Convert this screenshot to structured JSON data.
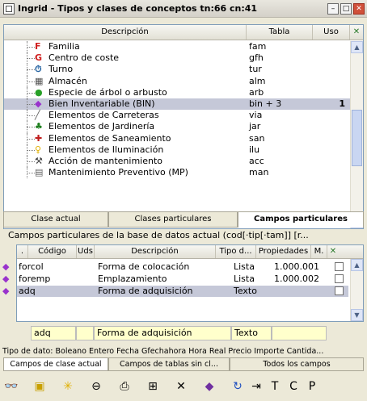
{
  "window": {
    "title": "Ingrid - Tipos y clases de conceptos tn:66 cn:41",
    "minimize": "–",
    "maximize": "□",
    "close": "✕"
  },
  "grid": {
    "columns": [
      "Descripción",
      "Tabla",
      "Uso"
    ],
    "rows": [
      {
        "icon": "letter-f-icon",
        "desc": "Familia",
        "tabla": "fam",
        "uso": ""
      },
      {
        "icon": "letter-g-icon",
        "desc": "Centro de coste",
        "tabla": "gfh",
        "uso": ""
      },
      {
        "icon": "shift-icon",
        "desc": "Turno",
        "tabla": "tur",
        "uso": ""
      },
      {
        "icon": "warehouse-icon",
        "desc": "Almacén",
        "tabla": "alm",
        "uso": ""
      },
      {
        "icon": "leaf-icon",
        "desc": "Especie de árbol o arbusto",
        "tabla": "arb",
        "uso": ""
      },
      {
        "icon": "gem-icon",
        "desc": "Bien Inventariable (BIN)",
        "tabla": "bin + 3",
        "uso": "1"
      },
      {
        "icon": "road-icon",
        "desc": "Elementos de Carreteras",
        "tabla": "via",
        "uso": ""
      },
      {
        "icon": "tree-icon",
        "desc": "Elementos de Jardinería",
        "tabla": "jar",
        "uso": ""
      },
      {
        "icon": "pipe-icon",
        "desc": "Elementos de Saneamiento",
        "tabla": "san",
        "uso": ""
      },
      {
        "icon": "bulb-icon",
        "desc": "Elementos de Iluminación",
        "tabla": "ilu",
        "uso": ""
      },
      {
        "icon": "wrench-icon",
        "desc": "Acción de mantenimiento",
        "tabla": "acc",
        "uso": ""
      },
      {
        "icon": "calendar-icon",
        "desc": "Mantenimiento Preventivo (MP)",
        "tabla": "man",
        "uso": ""
      }
    ]
  },
  "tabs": [
    "Clase actual",
    "Clases particulares",
    "Campos particulares"
  ],
  "caption": "Campos particulares de la base de datos actual (cod[·tip[·tam]] [r...",
  "fields_grid": {
    "columns": [
      ".",
      "Código",
      "Uds",
      "Descripción",
      "Tipo d...",
      "Propiedades",
      "M."
    ],
    "rows": [
      {
        "codigo": "forcol",
        "uds": "",
        "desc": "Forma de colocación",
        "tipo": "Lista",
        "prop": "1.000.001"
      },
      {
        "codigo": "foremp",
        "uds": "",
        "desc": "Emplazamiento",
        "tipo": "Lista",
        "prop": "1.000.002"
      },
      {
        "codigo": "adq",
        "uds": "",
        "desc": "Forma de adquisición",
        "tipo": "Texto",
        "prop": ""
      }
    ]
  },
  "edit": {
    "codigo": "adq",
    "uds": "",
    "desc": "Forma de adquisición",
    "tipo": "Texto",
    "prop": ""
  },
  "datatype_text": "Tipo de dato: Boleano Entero Fecha Gfechahora Hora Real Precio Importe Cantida...",
  "bottom_tabs": [
    "Campos de clase actual",
    "Campos de tablas sin cl...",
    "Todos los campos"
  ],
  "toolbar_icons": [
    "binoculars-icon",
    "folder-icon",
    "star-icon",
    "link-icon",
    "print-icon",
    "network-icon",
    "delete-icon",
    "book-icon",
    "refresh-icon",
    "import-icon",
    "panel-t-icon",
    "panel-c-icon",
    "panel-p-icon"
  ]
}
